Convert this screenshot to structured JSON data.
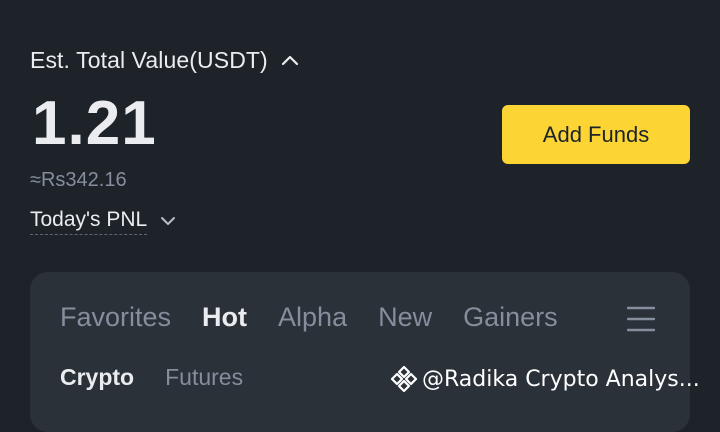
{
  "account": {
    "total_label": "Est. Total Value(USDT)",
    "balance": "1.21",
    "fiat_value": "≈Rs342.16",
    "pnl_label": "Today's PNL",
    "add_funds_label": "Add Funds"
  },
  "market": {
    "tabs": [
      {
        "label": "Favorites",
        "active": false
      },
      {
        "label": "Hot",
        "active": true
      },
      {
        "label": "Alpha",
        "active": false
      },
      {
        "label": "New",
        "active": false
      },
      {
        "label": "Gainers",
        "active": false
      }
    ],
    "menu_icon": "hamburger-menu-icon",
    "subtabs": [
      {
        "label": "Crypto",
        "active": true
      },
      {
        "label": "Futures",
        "active": false
      }
    ]
  },
  "watermark": {
    "logo_icon": "binance-diamond-logo",
    "text": "@Radika Crypto Analys..."
  },
  "colors": {
    "background": "#1e2329",
    "card": "#2b3139",
    "accent": "#fcd535",
    "text_primary": "#eaecef",
    "text_secondary": "#848e9c"
  }
}
